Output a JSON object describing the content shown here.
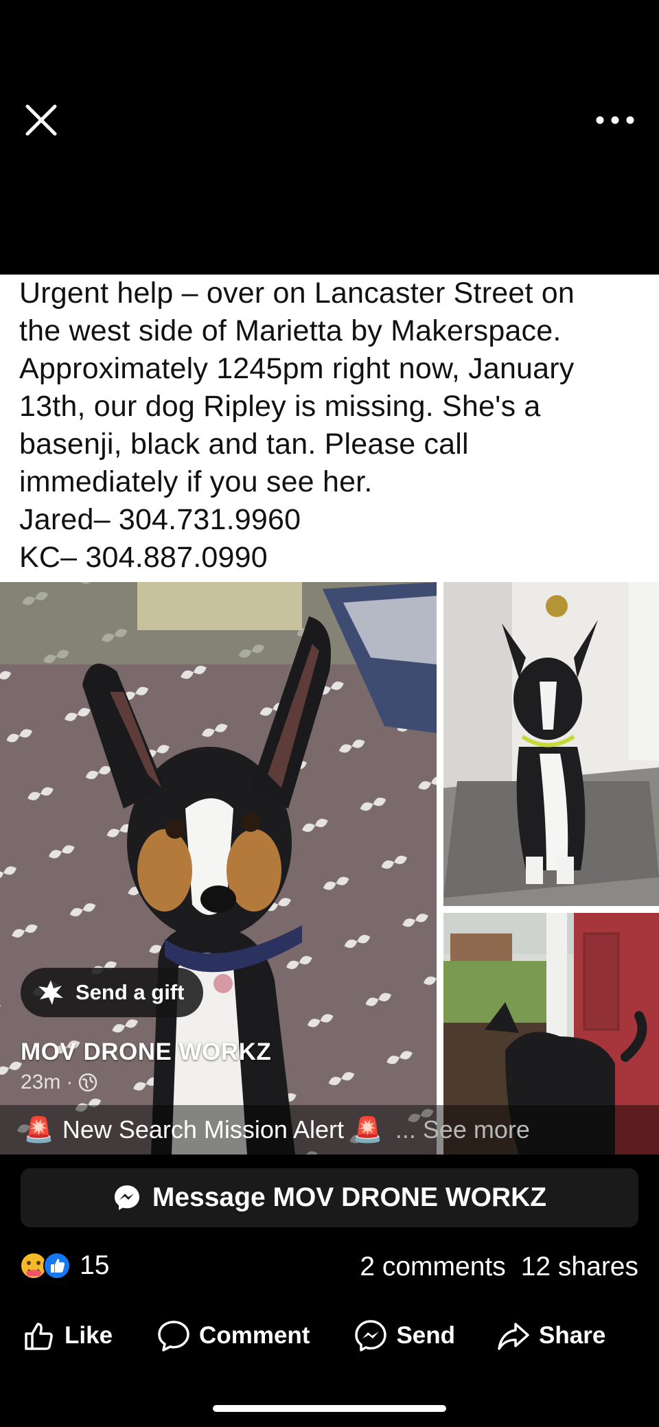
{
  "header": {
    "close_icon": "close-icon",
    "more_icon": "more-horizontal-icon"
  },
  "post": {
    "text": "Urgent help – over on Lancaster Street on\nthe west side of Marietta by Makerspace.\nApproximately 1245pm right now, January\n13th, our dog Ripley is missing. She's a\nbasenji, black and tan. Please call\nimmediately if you see her.\nJared– 304.731.9960\nKC– 304.887.0990",
    "page_name": "MOV DRONE WORKZ",
    "time": "23m",
    "caption": "New Search Mission Alert",
    "caption_emoji": "🚨",
    "see_more": "... See more",
    "gift_label": "Send a gift"
  },
  "message_button": "Message MOV DRONE WORKZ",
  "stats": {
    "reaction_count": "15",
    "comments": "2 comments",
    "shares": "12 shares"
  },
  "actions": [
    {
      "label": "Like",
      "icon": "like-icon"
    },
    {
      "label": "Comment",
      "icon": "comment-icon"
    },
    {
      "label": "Send",
      "icon": "messenger-icon"
    },
    {
      "label": "Share",
      "icon": "share-icon"
    }
  ],
  "colors": {
    "background": "#000000",
    "like_blue": "#1877f2",
    "care_yellow": "#f7b928"
  }
}
